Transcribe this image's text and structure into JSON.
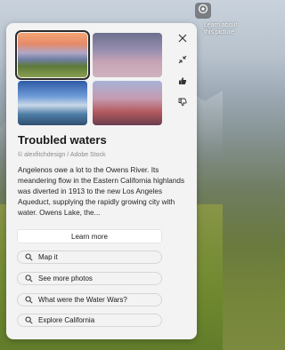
{
  "corner": {
    "text": "Learn about this picture"
  },
  "card": {
    "title": "Troubled waters",
    "credit": "© alexfitchdesign / Adobe Stock",
    "description": "Angelenos owe a lot to the Owens River. Its meandering flow in the Eastern California highlands was diverted in 1913 to the new Los Angeles Aqueduct, supplying the rapidly growing city with water. Owens Lake, the...",
    "learn_more": "Learn more",
    "chips": [
      {
        "label": "Map it"
      },
      {
        "label": "See more photos"
      },
      {
        "label": "What were the Water Wars?"
      },
      {
        "label": "Explore California"
      }
    ]
  },
  "icons": {
    "top": "camera-icon",
    "close": "close-icon",
    "collapse": "collapse-icon",
    "like": "thumbs-up-icon",
    "dislike": "thumbs-down-icon",
    "search": "search-icon"
  }
}
